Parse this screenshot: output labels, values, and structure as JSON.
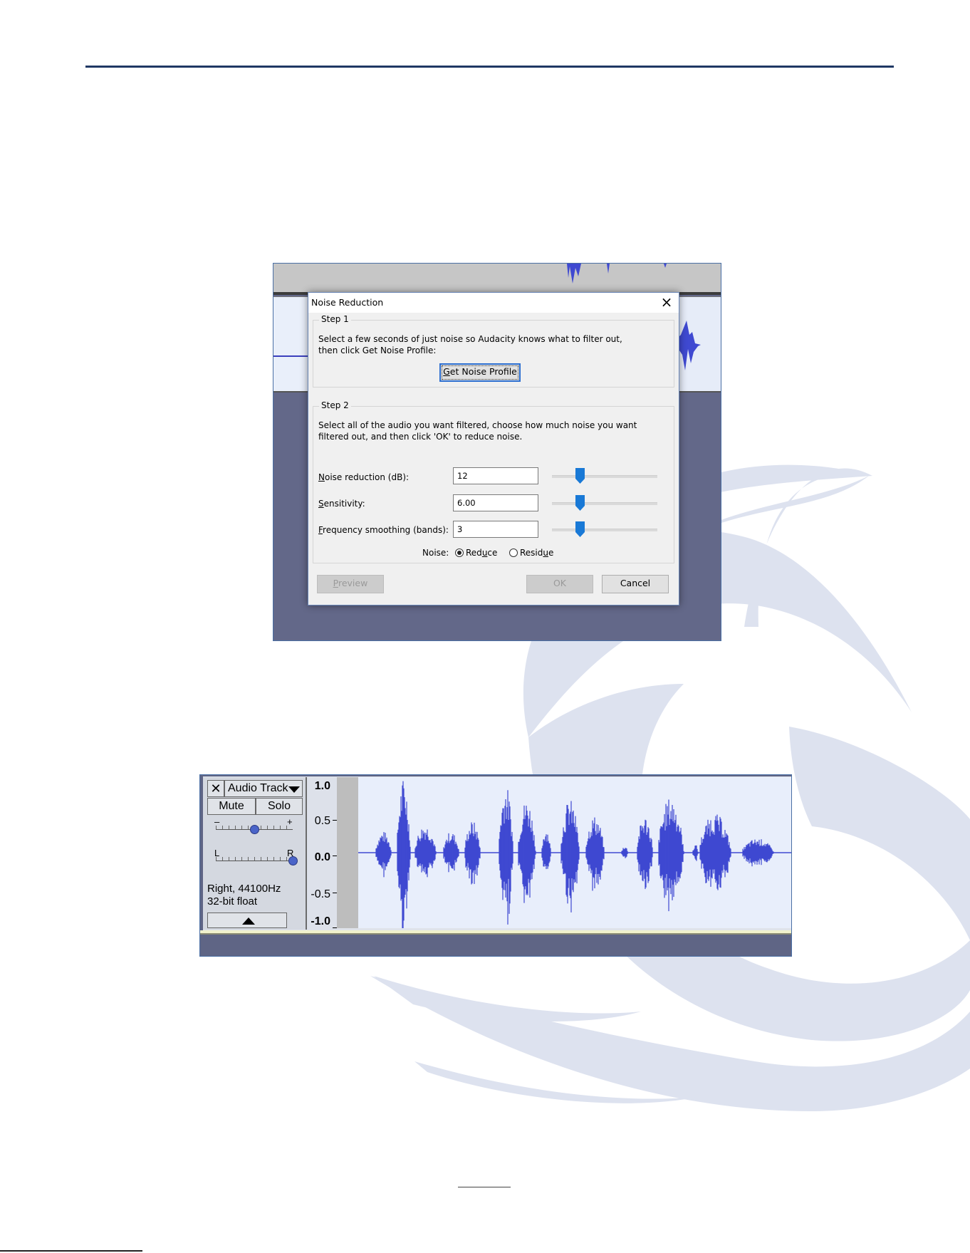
{
  "watermark": {
    "color": "#dde2ef"
  },
  "dialog": {
    "title": "Noise Reduction",
    "step1": {
      "label": "Step 1",
      "line1": "Select a few seconds of just noise so Audacity knows what to filter out,",
      "line2": "then click Get Noise Profile:",
      "button": "Get Noise Profile"
    },
    "step2": {
      "label": "Step 2",
      "line1": "Select all of the audio you want filtered, choose how much noise you want",
      "line2": "filtered out, and then click 'OK' to reduce noise."
    },
    "fields": [
      {
        "label": "Noise reduction (dB):",
        "value": "12"
      },
      {
        "label": "Sensitivity:",
        "value": "6.00"
      },
      {
        "label": "Frequency smoothing (bands):",
        "value": "3"
      }
    ],
    "noise": {
      "label": "Noise:",
      "reduce": "Reduce",
      "residue": "Residue",
      "selected": "Reduce"
    },
    "buttons": {
      "preview": "Preview",
      "ok": "OK",
      "cancel": "Cancel"
    },
    "accent": "#1979d6"
  },
  "track": {
    "close": "✕",
    "name": "Audio Track",
    "mute": "Mute",
    "solo": "Solo",
    "gain": {
      "minus": "–",
      "plus": "+",
      "level": 0.5
    },
    "pan": {
      "left": "L",
      "right": "R",
      "level": 1.0
    },
    "info1": "Right, 44100Hz",
    "info2": "32-bit float",
    "ruler": [
      "1.0",
      "0.5",
      "0.0",
      "-0.5",
      "-1.0"
    ],
    "waveform_color": "#3f49d1",
    "background_color": "#e8eefb"
  }
}
